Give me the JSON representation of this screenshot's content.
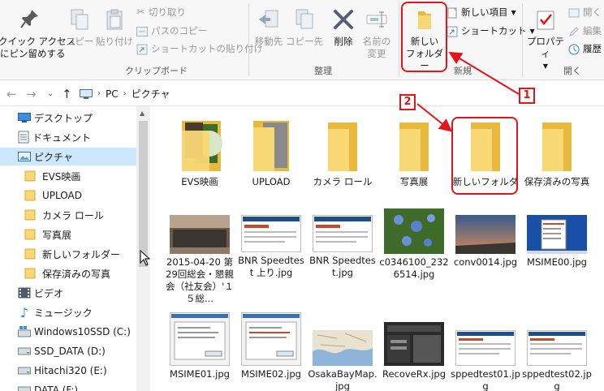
{
  "ribbon": {
    "pin_label": "クイック アクセス\nにピン留めする",
    "copy_label": "コピー",
    "paste_label": "貼り付け",
    "cut_label": "切り取り",
    "copy_path_label": "パスのコピー",
    "paste_shortcut_label": "ショートカットの貼り付け",
    "clipboard_group": "クリップボード",
    "move_to_label": "移動先",
    "copy_to_label": "コピー先",
    "delete_label": "削除",
    "rename_label": "名前の\n変更",
    "organize_group": "整理",
    "new_folder_label": "新しい\nフォルダー",
    "new_item_label": "新しい項目",
    "shortcut_label": "ショートカット",
    "new_group": "新規",
    "properties_label": "プロパティ",
    "open_label": "開く",
    "edit_label": "編集",
    "history_label": "履歴",
    "open_group": "開く"
  },
  "address": {
    "crumbs": [
      "PC",
      "ピクチャ"
    ]
  },
  "nav": {
    "items": [
      {
        "label": "デスクトップ"
      },
      {
        "label": "ドキュメント"
      },
      {
        "label": "ピクチャ"
      },
      {
        "label": "EVS映画"
      },
      {
        "label": "UPLOAD"
      },
      {
        "label": "カメラ ロール"
      },
      {
        "label": "写真展"
      },
      {
        "label": "新しいフォルダー"
      },
      {
        "label": "保存済みの写真"
      },
      {
        "label": "ビデオ"
      },
      {
        "label": "ミュージック"
      },
      {
        "label": "Windows10SSD (C:)"
      },
      {
        "label": "SSD_DATA (D:)"
      },
      {
        "label": "Hitachi320 (E:)"
      },
      {
        "label": "DATA (F:)"
      }
    ]
  },
  "files": {
    "row1": [
      "EVS映画",
      "UPLOAD",
      "カメラ ロール",
      "写真展",
      "新しいフォルダ",
      "保存済みの写真"
    ],
    "row2": [
      "2015-04-20 第29回総会・懇親会（社友会）'１５総...",
      "BNR Speedtest 上り.jpg",
      "BNR Speedtest.jpg",
      "c0346100_2326514.jpg",
      "conv0014.jpg",
      "MSIME00.jpg"
    ],
    "row3": [
      "MSIME01.jpg",
      "MSIME02.jpg",
      "OsakaBayMap.jpg",
      "RecoveRx.jpg",
      "sppedtest01.jpg",
      "sppedtest02.jpg"
    ]
  },
  "annotations": {
    "badge1": "1",
    "badge2": "2",
    "color": "#e5141a"
  },
  "colors": {
    "folder": "#f8d775",
    "selection": "#cce8ff"
  }
}
